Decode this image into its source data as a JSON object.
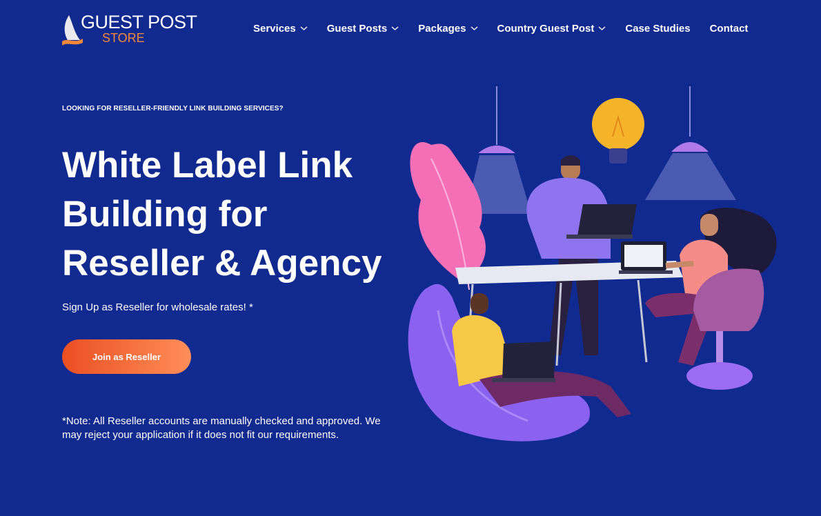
{
  "brand": {
    "line1": "GUEST POST",
    "line2": "STORE",
    "colors": {
      "white": "#ffffff",
      "orange": "#f5873a"
    }
  },
  "nav": {
    "items": [
      {
        "label": "Services",
        "has_dropdown": true
      },
      {
        "label": "Guest Posts",
        "has_dropdown": true
      },
      {
        "label": "Packages",
        "has_dropdown": true
      },
      {
        "label": "Country Guest Post",
        "has_dropdown": true
      },
      {
        "label": "Case Studies",
        "has_dropdown": false
      },
      {
        "label": "Contact",
        "has_dropdown": false
      }
    ]
  },
  "hero": {
    "eyebrow": "LOOKING FOR RESELLER-FRIENDLY LINK BUILDING SERVICES?",
    "headline_lines": [
      "White Label Link",
      "Building for",
      "Reseller & Agency"
    ],
    "subtext": "Sign Up as Reseller for wholesale rates! *",
    "cta_label": "Join as Reseller",
    "note": "*Note: All Reseller accounts are manually checked and approved. We may reject your application if it does not fit our requirements."
  },
  "theme": {
    "background": "#112a8f",
    "cta_gradient": [
      "#ea4f22",
      "#ff8e58"
    ]
  }
}
